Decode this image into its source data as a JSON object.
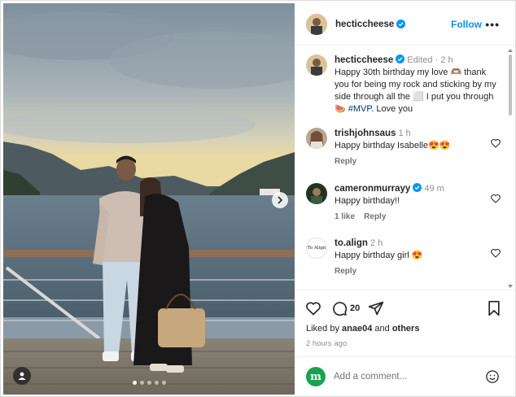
{
  "post": {
    "username": "hecticcheese",
    "follow_label": "Follow",
    "more_label": "•••",
    "caption": {
      "username": "hecticcheese",
      "edited": "Edited",
      "sep": "·",
      "age": "2 h",
      "text_before": "Happy 30th birthday my love 🫶🏽 thank you for being my rock and sticking by my side through all the ⬜ I put you through 🍉 ",
      "hashtag": "#MVP",
      "text_after": ". Love you"
    },
    "comments": [
      {
        "username": "trishjohnsaus",
        "age": "1 h",
        "text": "Happy birthday Isabelle😍😍",
        "reply": "Reply",
        "likes": ""
      },
      {
        "username": "cameronmurrayy",
        "age": "49 m",
        "text": "Happy birthday!!",
        "likes": "1 like",
        "reply": "Reply"
      },
      {
        "username": "to.align",
        "age": "2 h",
        "text": "Happy birthday girl 😍",
        "reply": "Reply",
        "likes": "",
        "avatar_text": "To Align"
      }
    ],
    "comment_count": "20",
    "liked_by_prefix": "Liked by ",
    "liked_by_user": "anae04",
    "liked_by_and": " and ",
    "liked_by_others": "others",
    "time": "2 hours ago",
    "add_comment_placeholder": "Add a comment...",
    "add_avatar_letter": "m",
    "carousel": {
      "count": 5,
      "active": 0
    }
  },
  "colors": {
    "accent": "#0095f6",
    "verified": "#0095f6",
    "hashtag": "#00376b",
    "muted": "#8e8e8e"
  }
}
